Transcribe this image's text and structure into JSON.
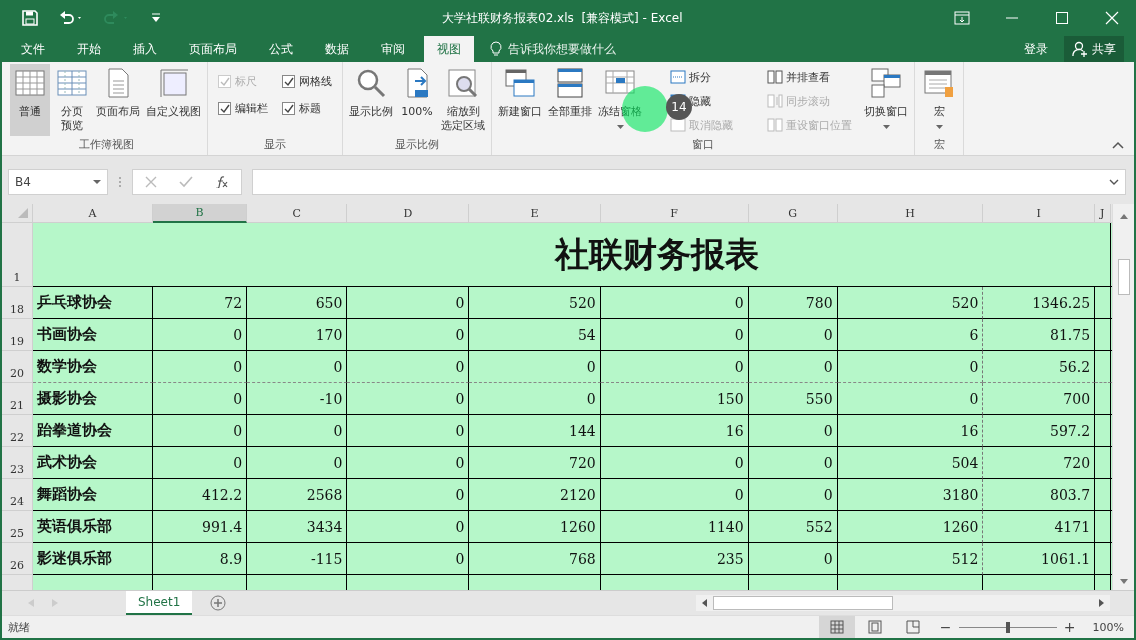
{
  "title_bar": {
    "title": "大学社联财务报表02.xls  [兼容模式] - Excel"
  },
  "menu_tabs": [
    {
      "label": "文件",
      "selected": false
    },
    {
      "label": "开始",
      "selected": false
    },
    {
      "label": "插入",
      "selected": false
    },
    {
      "label": "页面布局",
      "selected": false
    },
    {
      "label": "公式",
      "selected": false
    },
    {
      "label": "数据",
      "selected": false
    },
    {
      "label": "审阅",
      "selected": false
    },
    {
      "label": "视图",
      "selected": true
    }
  ],
  "tell_me": {
    "placeholder": "告诉我你想要做什么"
  },
  "sign_in": "登录",
  "share": "共享",
  "ribbon": {
    "groups": [
      {
        "label": "工作簿视图",
        "items": [
          {
            "kind": "large",
            "label": "普通",
            "selected": true
          },
          {
            "kind": "large",
            "label_lines": [
              "分页",
              "预览"
            ],
            "selected": false
          },
          {
            "kind": "large",
            "label": "页面布局",
            "selected": false
          },
          {
            "kind": "large",
            "label": "自定义视图",
            "selected": false
          }
        ]
      },
      {
        "label": "显示",
        "items": [
          {
            "kind": "check",
            "label": "标尺",
            "checked": true,
            "disabled": true
          },
          {
            "kind": "check",
            "label": "编辑栏",
            "checked": true,
            "disabled": false
          },
          {
            "kind": "check",
            "label": "网格线",
            "checked": true,
            "disabled": false
          },
          {
            "kind": "check",
            "label": "标题",
            "checked": true,
            "disabled": false
          }
        ]
      },
      {
        "label": "显示比例",
        "items": [
          {
            "kind": "large",
            "label": "显示比例"
          },
          {
            "kind": "large",
            "label": "100%"
          },
          {
            "kind": "large",
            "label_lines": [
              "缩放到",
              "选定区域"
            ]
          }
        ]
      },
      {
        "label": "窗口",
        "items": [
          {
            "kind": "large",
            "label": "新建窗口"
          },
          {
            "kind": "large",
            "label": "全部重排"
          },
          {
            "kind": "large",
            "label": "冻结窗格",
            "dropdown": true
          },
          {
            "kind": "small",
            "label": "拆分",
            "disabled": false
          },
          {
            "kind": "small",
            "label": "隐藏",
            "disabled": false
          },
          {
            "kind": "small",
            "label": "取消隐藏",
            "disabled": true
          },
          {
            "kind": "small",
            "label": "并排查看",
            "disabled": false
          },
          {
            "kind": "small",
            "label": "同步滚动",
            "disabled": true
          },
          {
            "kind": "small",
            "label": "重设窗口位置",
            "disabled": true
          },
          {
            "kind": "large",
            "label": "切换窗口",
            "dropdown": true
          }
        ]
      },
      {
        "label": "宏",
        "items": [
          {
            "kind": "large",
            "label": "宏",
            "dropdown": true
          }
        ]
      }
    ]
  },
  "click_marker": {
    "label": "14"
  },
  "formula_bar": {
    "name_box": "B4"
  },
  "sheet": {
    "columns": [
      {
        "label": "A",
        "selected": false,
        "page_break": false
      },
      {
        "label": "B",
        "selected": true,
        "page_break": false
      },
      {
        "label": "C",
        "selected": false,
        "page_break": false
      },
      {
        "label": "D",
        "selected": false,
        "page_break": false
      },
      {
        "label": "E",
        "selected": false,
        "page_break": false
      },
      {
        "label": "F",
        "selected": false,
        "page_break": false
      },
      {
        "label": "G",
        "selected": false,
        "page_break": false
      },
      {
        "label": "H",
        "selected": false,
        "page_break": true
      },
      {
        "label": "I",
        "selected": false,
        "page_break": false
      },
      {
        "label": "J",
        "selected": false,
        "page_break": false
      }
    ],
    "title_row": {
      "number": "1",
      "title": "社联财务报表"
    },
    "rows": [
      {
        "number": "18",
        "page_break": false,
        "cells": [
          "乒乓球协会",
          "72",
          "650",
          "0",
          "520",
          "0",
          "780",
          "520",
          "1346.25"
        ]
      },
      {
        "number": "19",
        "page_break": false,
        "cells": [
          "书画协会",
          "0",
          "170",
          "0",
          "54",
          "0",
          "0",
          "6",
          "81.75"
        ]
      },
      {
        "number": "20",
        "page_break": true,
        "cells": [
          "数学协会",
          "0",
          "0",
          "0",
          "0",
          "0",
          "0",
          "0",
          "56.2"
        ]
      },
      {
        "number": "21",
        "page_break": false,
        "cells": [
          "摄影协会",
          "0",
          "-10",
          "0",
          "0",
          "150",
          "550",
          "0",
          "700"
        ]
      },
      {
        "number": "22",
        "page_break": false,
        "cells": [
          "跆拳道协会",
          "0",
          "0",
          "0",
          "144",
          "16",
          "0",
          "16",
          "597.2"
        ]
      },
      {
        "number": "23",
        "page_break": false,
        "cells": [
          "武术协会",
          "0",
          "0",
          "0",
          "720",
          "0",
          "0",
          "504",
          "720"
        ]
      },
      {
        "number": "24",
        "page_break": false,
        "cells": [
          "舞蹈协会",
          "412.2",
          "2568",
          "0",
          "2120",
          "0",
          "0",
          "3180",
          "803.7"
        ]
      },
      {
        "number": "25",
        "page_break": false,
        "cells": [
          "英语俱乐部",
          "991.4",
          "3434",
          "0",
          "1260",
          "1140",
          "552",
          "1260",
          "4171"
        ]
      },
      {
        "number": "26",
        "page_break": false,
        "cells": [
          "影迷俱乐部",
          "8.9",
          "-115",
          "0",
          "768",
          "235",
          "0",
          "512",
          "1061.1"
        ]
      }
    ]
  },
  "sheet_tabs": [
    {
      "label": "Sheet1",
      "selected": true
    }
  ],
  "status_bar": {
    "status": "就绪",
    "views": [
      {
        "selected": true
      },
      {
        "selected": false
      },
      {
        "selected": false
      }
    ],
    "zoom": {
      "zoom_out": "−",
      "level": 0.5,
      "zoom_in": "+",
      "label": "100%"
    }
  }
}
